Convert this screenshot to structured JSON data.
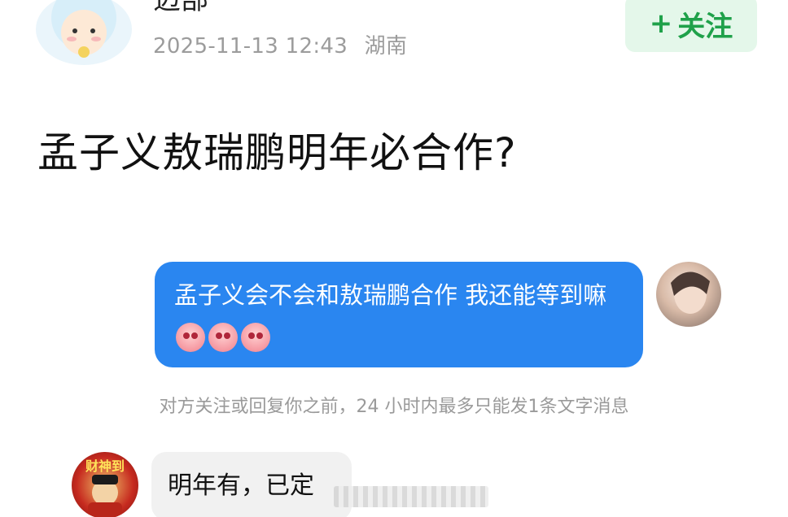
{
  "header": {
    "author_name": "迈部",
    "timestamp": "2025-11-13 12:43",
    "location": "湖南",
    "follow_plus": "+",
    "follow_label": "关注"
  },
  "post": {
    "title": "孟子义敖瑞鹏明年必合作?"
  },
  "chat": {
    "sent_message": "孟子义会不会和敖瑞鹏合作 我还能等到嘛",
    "notice": "对方关注或回复你之前，24 小时内最多只能发1条文字消息",
    "reply_message": "明年有，已定",
    "reply_avatar_text": "财神到"
  },
  "icons": {
    "sent_emoji": "peach-face-emoji"
  },
  "colors": {
    "sent_bubble": "#2a86f0",
    "follow_text": "#1fa14a",
    "follow_bg": "#e4f7ea",
    "notice_text": "#9a9a9a"
  }
}
